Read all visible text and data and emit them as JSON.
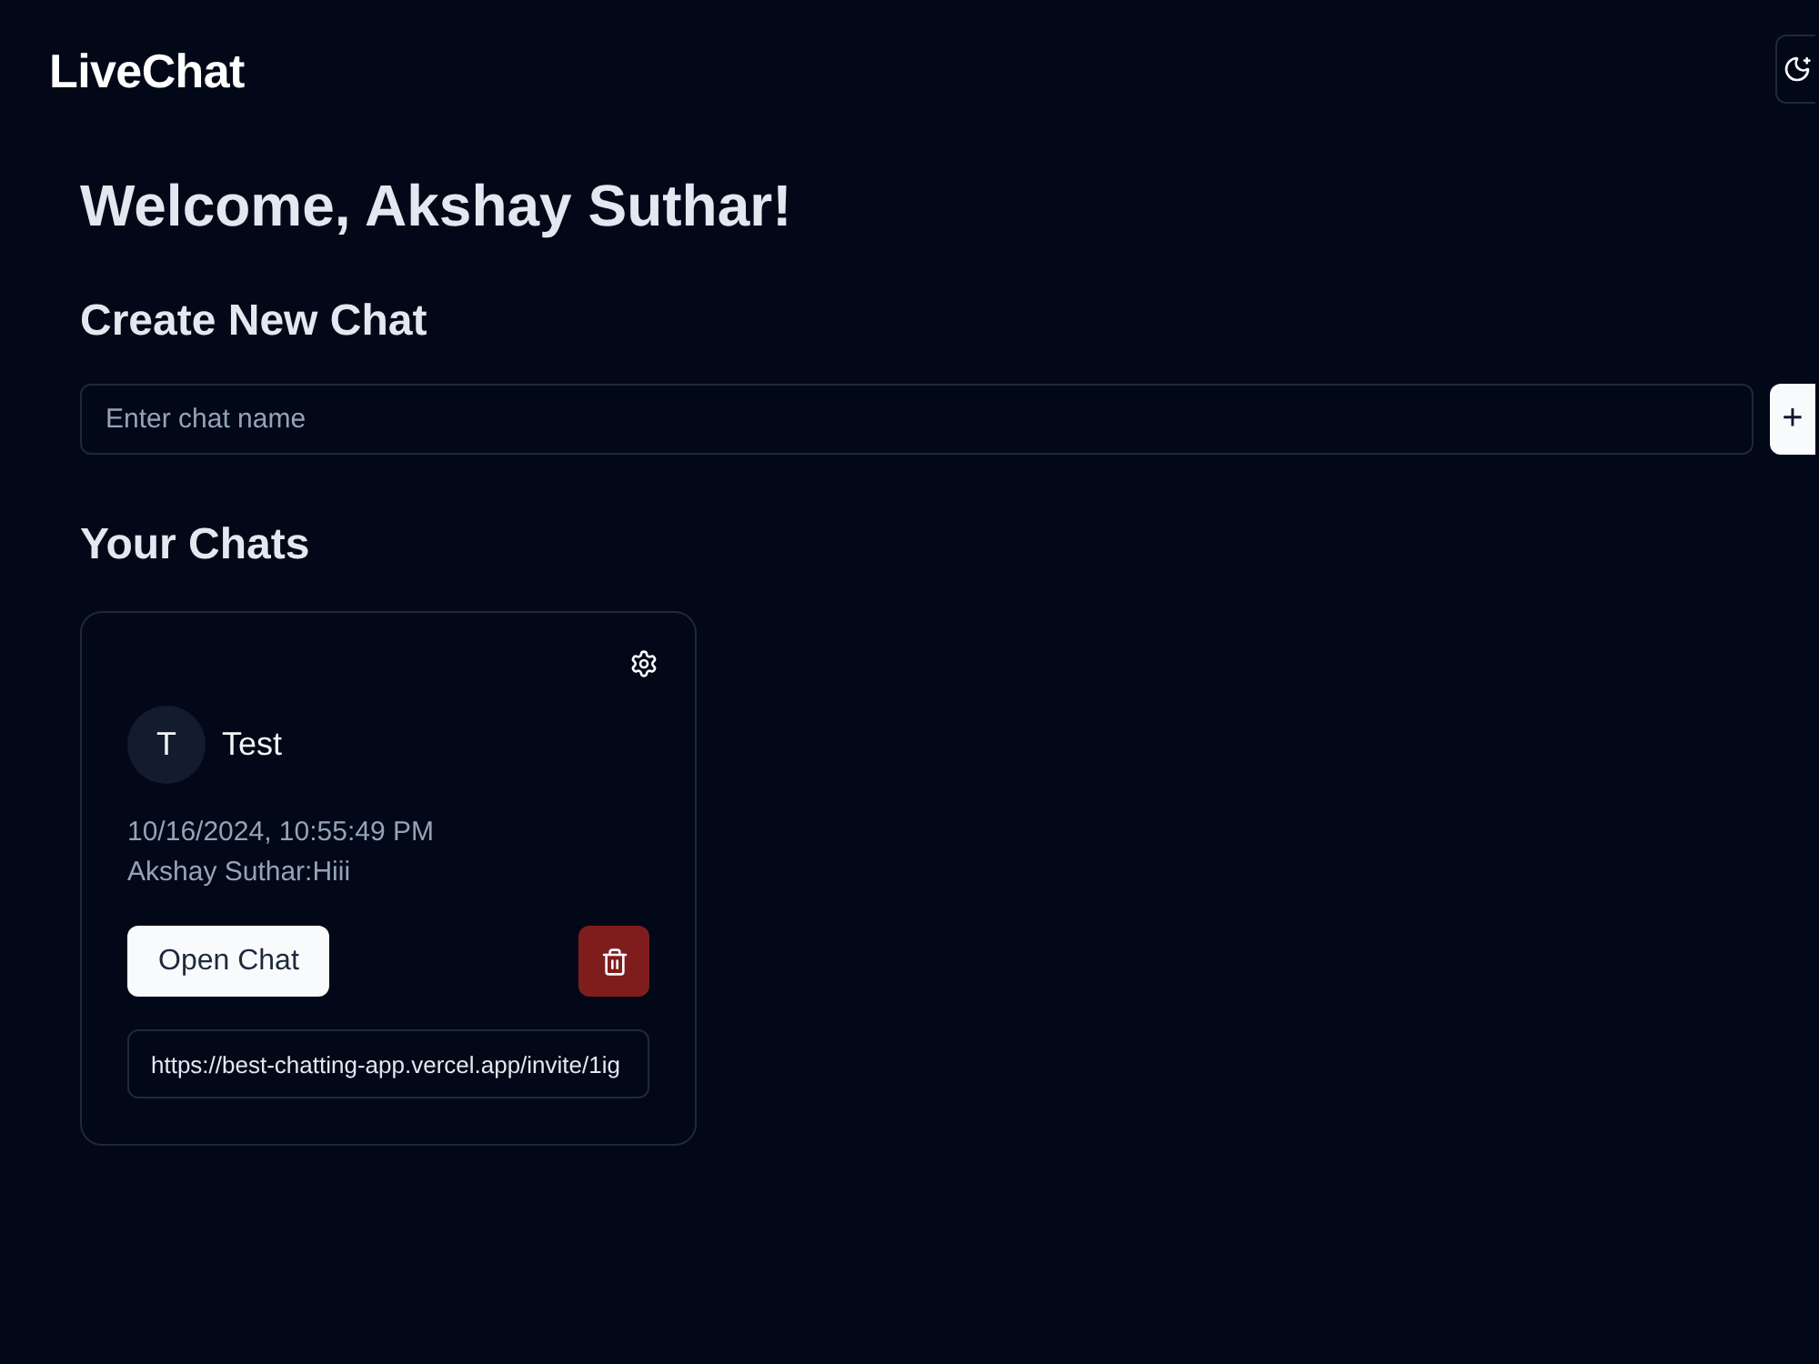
{
  "header": {
    "logo": "LiveChat"
  },
  "welcome": "Welcome, Akshay Suthar!",
  "create_chat": {
    "heading": "Create New Chat",
    "input": {
      "placeholder": "Enter chat name"
    },
    "button": "+"
  },
  "your_chats": {
    "heading": "Your Chats",
    "chats": [
      {
        "avatar_letter": "T",
        "name": "Test",
        "timestamp": "10/16/2024, 10:55:49 PM",
        "last_message": "Akshay Suthar:Hiii",
        "open_button": "Open Chat",
        "invite_link": "https://best-chatting-app.vercel.app/invite/1ig"
      }
    ]
  }
}
